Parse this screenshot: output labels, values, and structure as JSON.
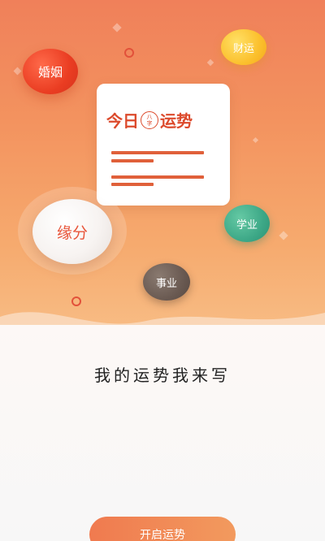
{
  "bubbles": {
    "marriage": "婚姻",
    "wealth": "财运",
    "fate": "缘分",
    "study": "学业",
    "career": "事业"
  },
  "card": {
    "title_left": "今日",
    "seal_top": "八",
    "seal_bottom": "字",
    "title_right": "运势"
  },
  "slogan": "我的运势我来写",
  "start_button": "开启运势",
  "colors": {
    "accent": "#f07a4f",
    "marriage": "#ea3d22",
    "wealth": "#fbc02d",
    "study": "#3da887",
    "career": "#6a5a52",
    "fate_text": "#e8553a"
  }
}
